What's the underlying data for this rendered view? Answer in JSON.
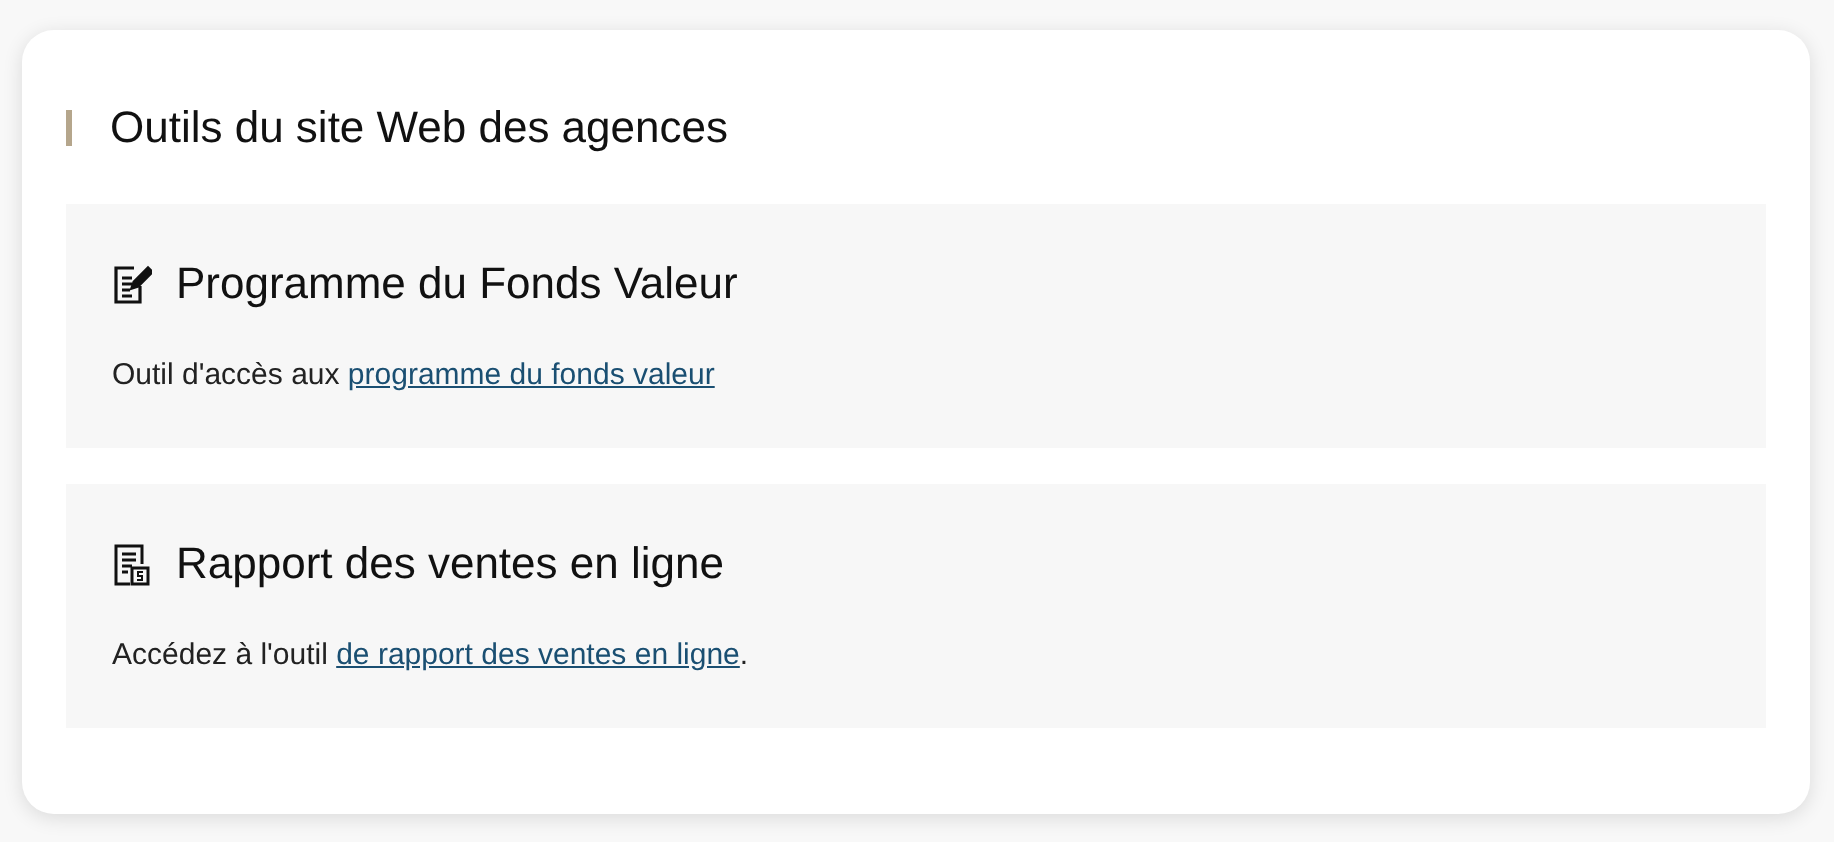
{
  "title": "Outils du site Web des agences",
  "tools": [
    {
      "kind": "form",
      "title": "Programme du Fonds Valeur",
      "text": "Outil d'accès aux ",
      "link": "programme du fonds valeur"
    },
    {
      "kind": "report",
      "title": "Rapport des ventes en ligne",
      "text": "Accédez à l'outil ",
      "link": "de rapport des ventes en ligne",
      "suffix": "."
    }
  ]
}
